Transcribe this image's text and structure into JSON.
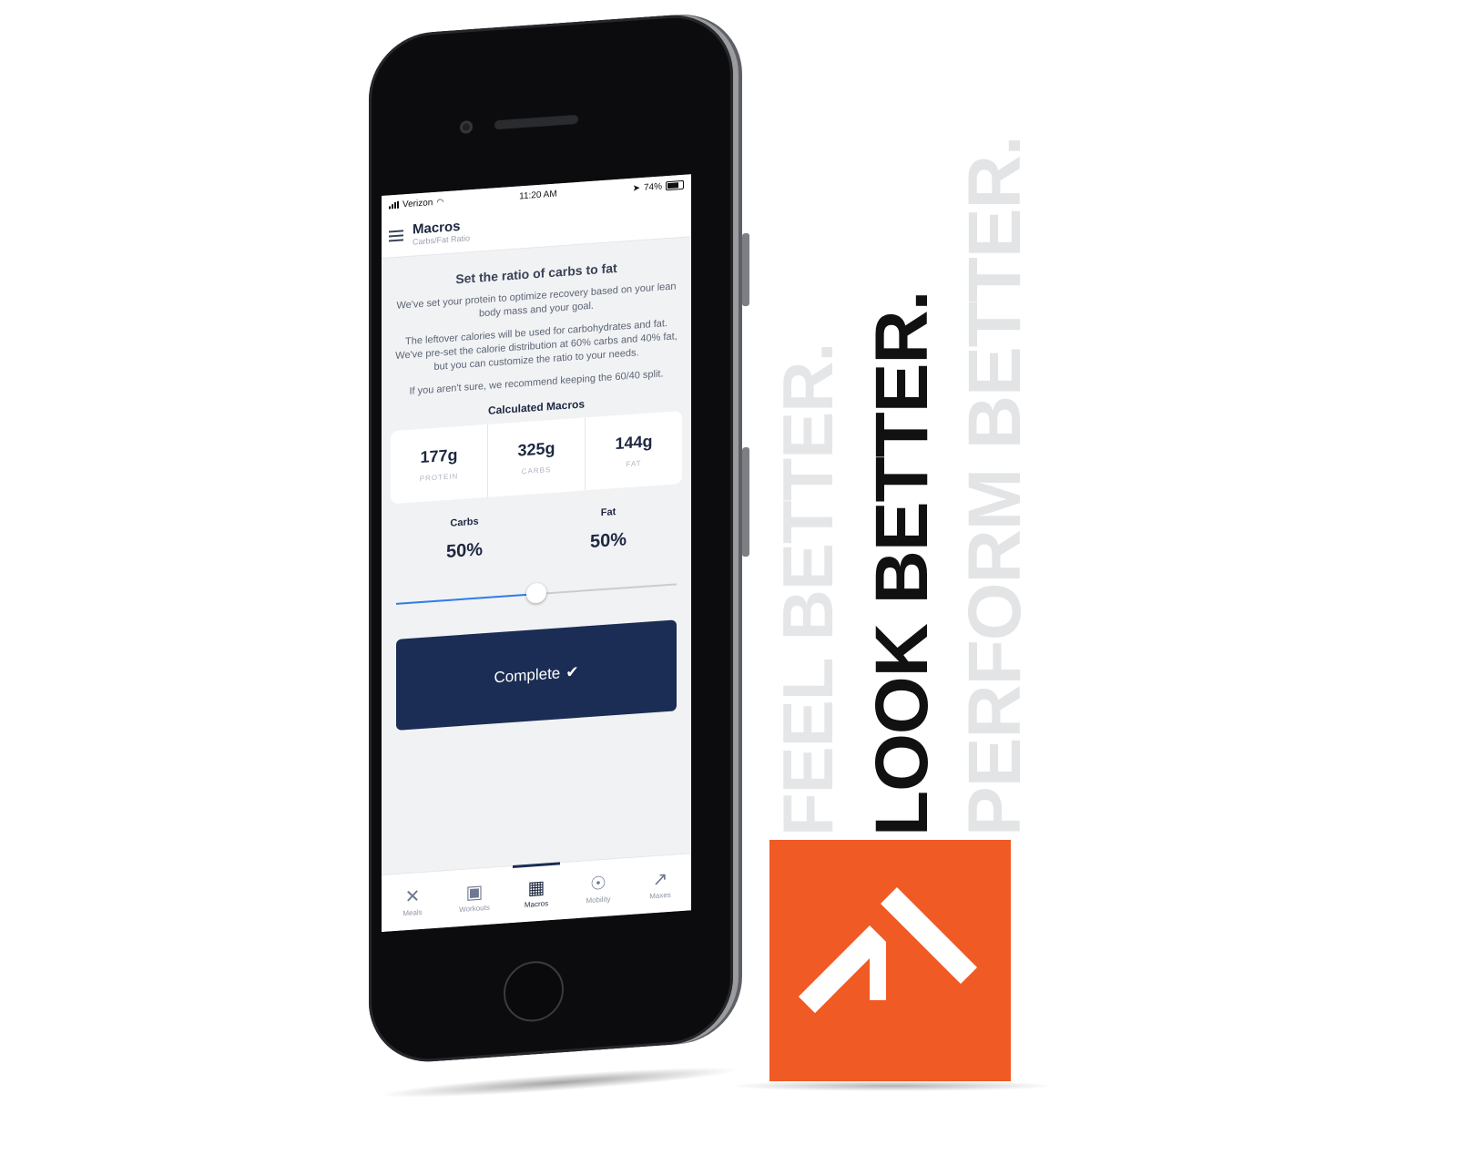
{
  "status_bar": {
    "carrier": "Verizon",
    "time": "11:20 AM",
    "battery": "74%"
  },
  "header": {
    "title": "Macros",
    "subtitle": "Carbs/Fat Ratio"
  },
  "content": {
    "lead": "Set the ratio of carbs to fat",
    "paragraphs": [
      "We've set your protein to optimize recovery based on your lean body mass and your goal.",
      "The leftover calories will be used for carbohydrates and fat. We've pre-set the calorie distribution at 60% carbs and 40% fat, but you can customize the ratio to your needs.",
      "If you aren't sure, we recommend keeping the 60/40 split."
    ],
    "calculated_label": "Calculated Macros",
    "macros": [
      {
        "value": "177g",
        "label": "PROTEIN"
      },
      {
        "value": "325g",
        "label": "CARBS"
      },
      {
        "value": "144g",
        "label": "FAT"
      }
    ],
    "ratio": {
      "carbs_label": "Carbs",
      "carbs_value": "50%",
      "fat_label": "Fat",
      "fat_value": "50%",
      "slider_fraction": 0.5
    },
    "complete_button": "Complete",
    "complete_icon": "checkmark-icon"
  },
  "tabs": [
    {
      "label": "Meals",
      "icon": "fork-knife-icon",
      "active": false
    },
    {
      "label": "Workouts",
      "icon": "calendar-icon",
      "active": false
    },
    {
      "label": "Macros",
      "icon": "calculator-icon",
      "active": true
    },
    {
      "label": "Mobility",
      "icon": "person-icon",
      "active": false
    },
    {
      "label": "Maxes",
      "icon": "chart-icon",
      "active": false
    }
  ],
  "branding": {
    "slogan": [
      "FEEL BETTER.",
      "LOOK BETTER.",
      "PERFORM BETTER."
    ],
    "logo_color": "#f05a24"
  },
  "colors": {
    "primary": "#1b2d54",
    "slider": "#2f7fe8"
  }
}
